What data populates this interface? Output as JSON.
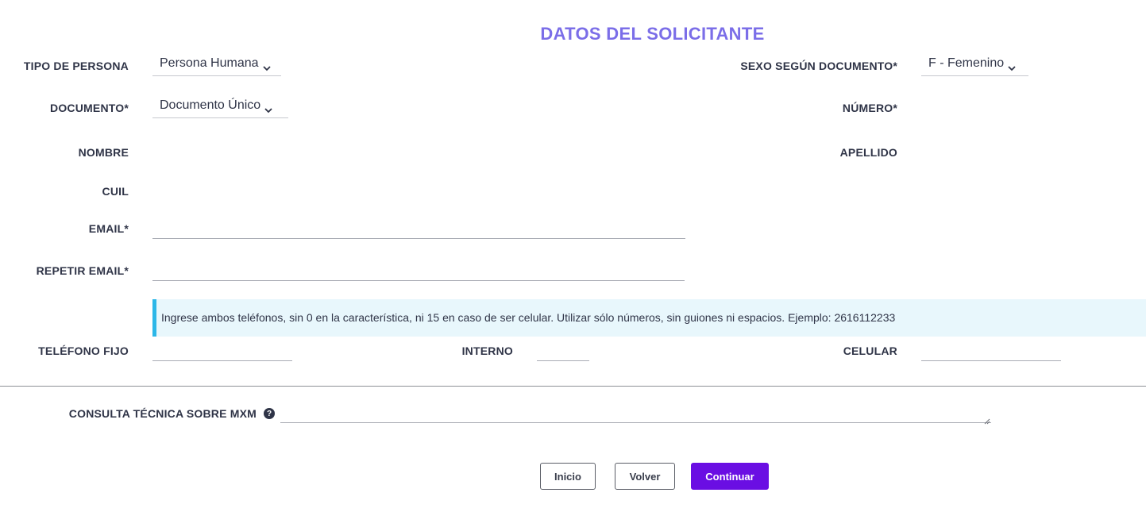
{
  "page": {
    "title": "DATOS DEL SOLICITANTE",
    "accent_color": "#7b6ee8",
    "primary_color": "#6a0ee3"
  },
  "form": {
    "tipo_persona": {
      "label": "TIPO DE PERSONA",
      "value": "Persona Humana"
    },
    "sexo": {
      "label": "SEXO SEGÚN DOCUMENTO*",
      "value": "F - Femenino"
    },
    "documento": {
      "label": "DOCUMENTO*",
      "value": "Documento Único"
    },
    "numero": {
      "label": "NÚMERO*"
    },
    "nombre": {
      "label": "NOMBRE"
    },
    "apellido": {
      "label": "APELLIDO"
    },
    "cuil": {
      "label": "CUIL"
    },
    "email": {
      "label": "EMAIL*",
      "value": ""
    },
    "repetir_email": {
      "label": "REPETIR EMAIL*",
      "value": ""
    },
    "phone_info": "Ingrese ambos teléfonos, sin 0 en la característica, ni 15 en caso de ser celular. Utilizar sólo números, sin guiones ni espacios. Ejemplo: 2616112233",
    "telefono_fijo": {
      "label": "TELÉFONO FIJO",
      "value": ""
    },
    "interno": {
      "label": "INTERNO",
      "value": ""
    },
    "celular": {
      "label": "CELULAR",
      "value": ""
    },
    "consulta": {
      "label": "CONSULTA TÉCNICA SOBRE MXM",
      "value": "",
      "help_icon": "question-circle-icon"
    }
  },
  "buttons": {
    "inicio": "Inicio",
    "volver": "Volver",
    "continuar": "Continuar"
  }
}
